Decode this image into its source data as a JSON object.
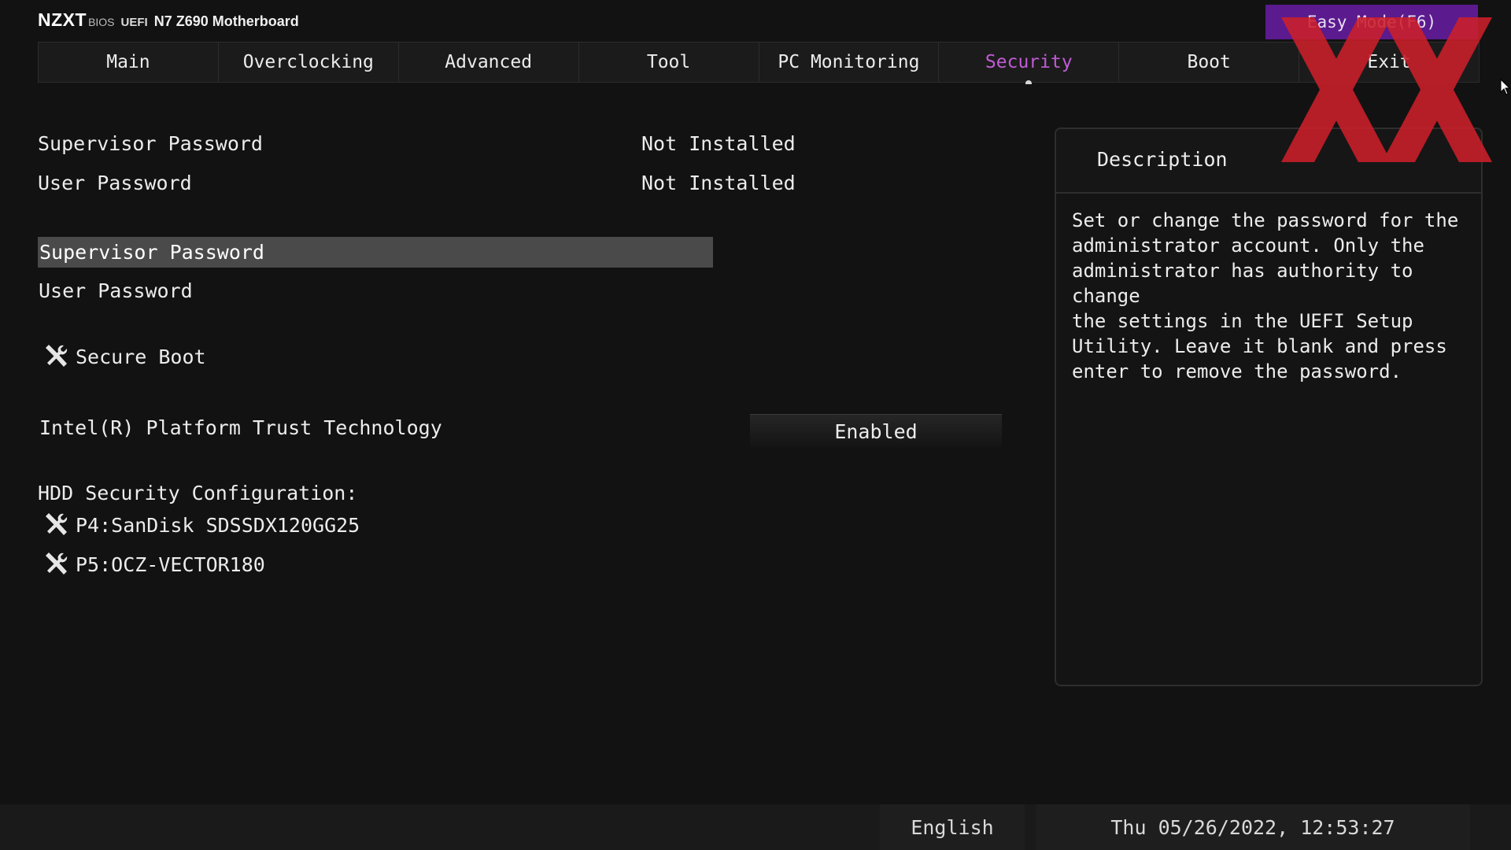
{
  "header": {
    "brand": "NZXT",
    "bios": "BIOS",
    "uefi": "UEFI",
    "model": "N7 Z690 Motherboard",
    "easy_mode": "Easy Mode(F6)"
  },
  "tabs": [
    {
      "label": "Main"
    },
    {
      "label": "Overclocking"
    },
    {
      "label": "Advanced"
    },
    {
      "label": "Tool"
    },
    {
      "label": "PC Monitoring"
    },
    {
      "label": "Security",
      "active": true
    },
    {
      "label": "Boot"
    },
    {
      "label": "Exit"
    }
  ],
  "status": {
    "supervisor_label": "Supervisor Password",
    "supervisor_value": "Not Installed",
    "user_label": "User Password",
    "user_value": "Not Installed"
  },
  "items": {
    "supervisor_password": "Supervisor Password",
    "user_password": "User Password",
    "secure_boot": "Secure Boot",
    "ptt_label": "Intel(R) Platform Trust Technology",
    "ptt_value": "Enabled",
    "hdd_heading": "HDD Security Configuration:",
    "hdd_drives": [
      "P4:SanDisk SDSSDX120GG25",
      "P5:OCZ-VECTOR180"
    ]
  },
  "description": {
    "title": "Description",
    "text": "Set or change the password for the\nadministrator account. Only the\nadministrator has authority to change\nthe settings in the UEFI Setup\nUtility. Leave it blank and press\nenter to remove the password."
  },
  "footer": {
    "language": "English",
    "datetime": "Thu 05/26/2022, 12:53:27"
  },
  "colors": {
    "active_tab": "#c25bd7",
    "easy_mode_bg": "#5b1a8e",
    "watermark": "#cc1f2a",
    "selection_bg": "#4a4a4a"
  },
  "icons": {
    "tool": "wrench-screwdriver-icon",
    "watermark": "xx-logo-watermark"
  }
}
